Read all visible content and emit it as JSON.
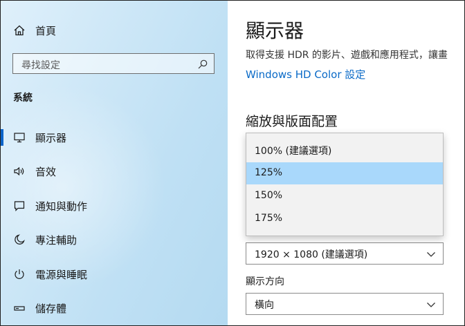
{
  "sidebar": {
    "home_label": "首頁",
    "search_placeholder": "尋找設定",
    "section_title": "系統",
    "items": [
      {
        "label": "顯示器",
        "icon": "monitor-icon"
      },
      {
        "label": "音效",
        "icon": "speaker-icon"
      },
      {
        "label": "通知與動作",
        "icon": "notification-icon"
      },
      {
        "label": "專注輔助",
        "icon": "moon-icon"
      },
      {
        "label": "電源與睡眠",
        "icon": "power-icon"
      },
      {
        "label": "儲存體",
        "icon": "storage-icon"
      }
    ],
    "active_index": 0
  },
  "main": {
    "title": "顯示器",
    "description": "取得支援 HDR 的影片、遊戲和應用程式，讓畫",
    "hdr_link": "Windows HD Color 設定",
    "scale_heading": "縮放與版面配置",
    "scale_options": [
      "100% (建議選項)",
      "125%",
      "150%",
      "175%"
    ],
    "scale_selected_index": 1,
    "resolution_value": "1920 × 1080 (建議選項)",
    "orientation_label": "顯示方向",
    "orientation_value": "橫向"
  },
  "colors": {
    "accent": "#0a63c9",
    "link": "#0a6ac7",
    "selected_option": "#a9d8fb"
  }
}
